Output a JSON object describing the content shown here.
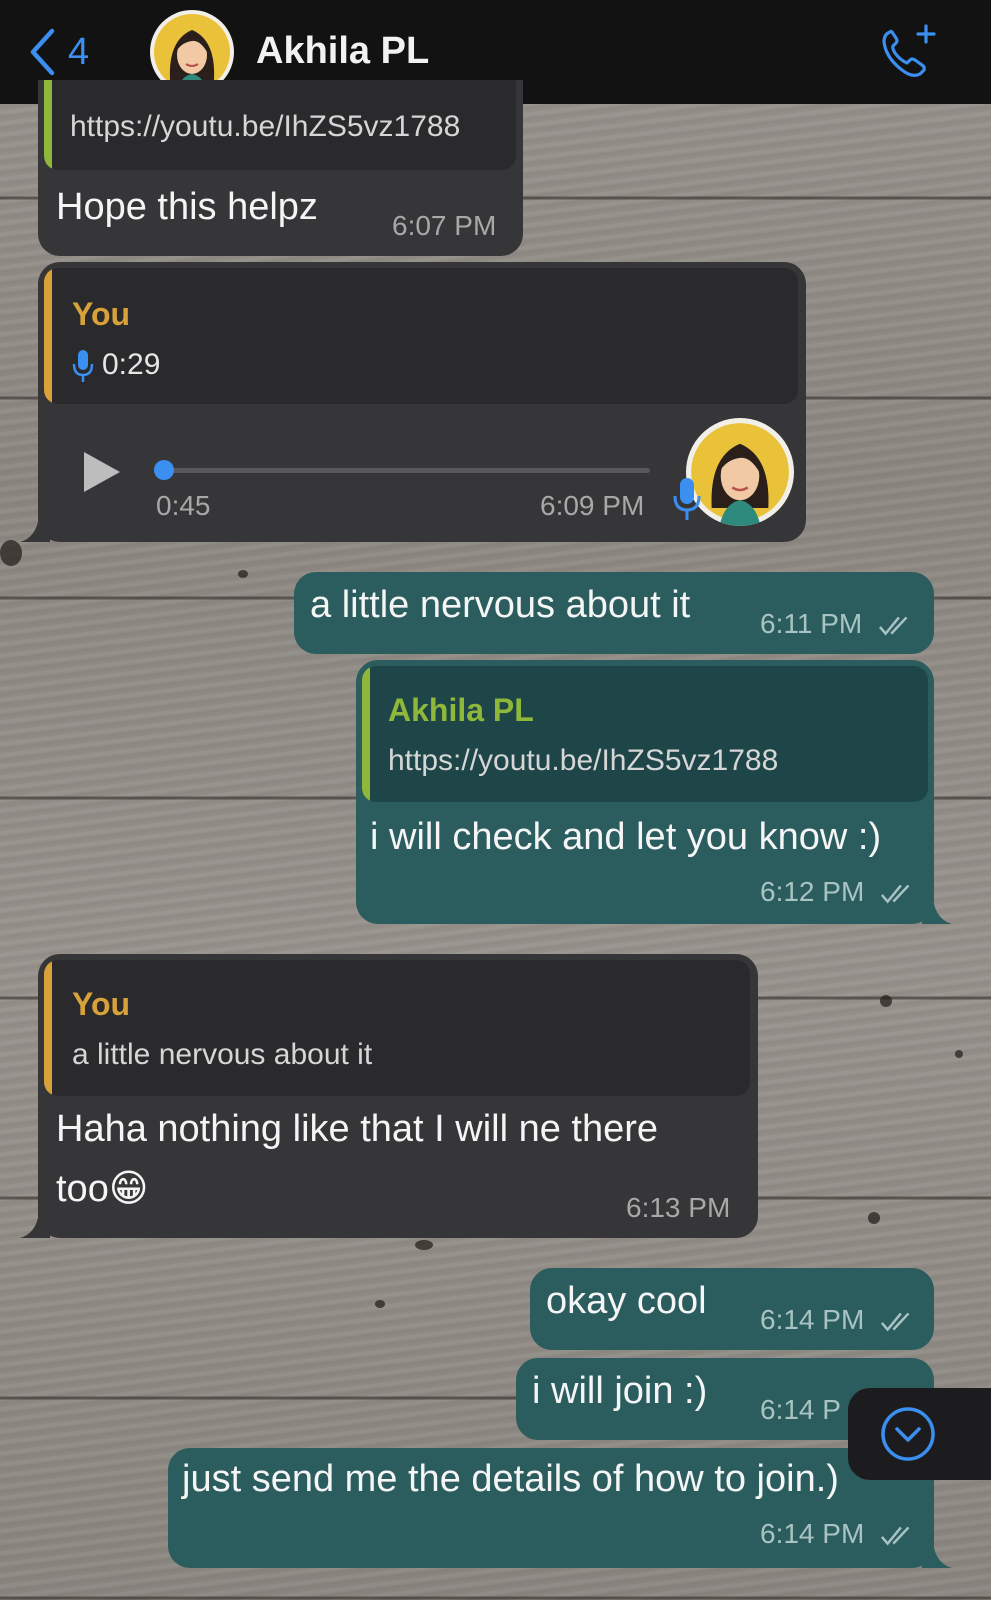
{
  "header": {
    "back_count": "4",
    "contact_name": "Akhila PL",
    "back_icon": "chevron-left-icon",
    "call_icon": "add-call-icon"
  },
  "colors": {
    "accent": "#3b8ff0",
    "incoming_bubble": "#363638",
    "outgoing_bubble": "#2b5d5f",
    "quote_you": "#d9a13a",
    "quote_contact": "#8fb83a"
  },
  "messages": [
    {
      "direction": "incoming",
      "quote_text": "https://youtu.be/IhZS5vz1788",
      "text": "Hope this helpz",
      "time": "6:07 PM"
    },
    {
      "direction": "incoming",
      "type": "voice",
      "quote_author": "You",
      "quote_duration": "0:29",
      "voice_elapsed": "0:45",
      "voice_progress": 0,
      "time": "6:09 PM"
    },
    {
      "direction": "outgoing",
      "text": "a little nervous about it",
      "time": "6:11 PM"
    },
    {
      "direction": "outgoing",
      "quote_author": "Akhila PL",
      "quote_text": "https://youtu.be/IhZS5vz1788",
      "text": "i will check and let you know :)",
      "time": "6:12 PM"
    },
    {
      "direction": "incoming",
      "quote_author": "You",
      "quote_text": "a little nervous about it",
      "text_line1": "Haha nothing like that I will ne there",
      "text_line2": "too😁",
      "time": "6:13 PM"
    },
    {
      "direction": "outgoing",
      "text": "okay cool",
      "time": "6:14 PM"
    },
    {
      "direction": "outgoing",
      "text": "i will join :)",
      "time": "6:14 P"
    },
    {
      "direction": "outgoing",
      "text": "just send me the details of how to join.)",
      "time": "6:14 PM"
    }
  ],
  "scroll_button_icon": "chevron-down-circle-icon"
}
